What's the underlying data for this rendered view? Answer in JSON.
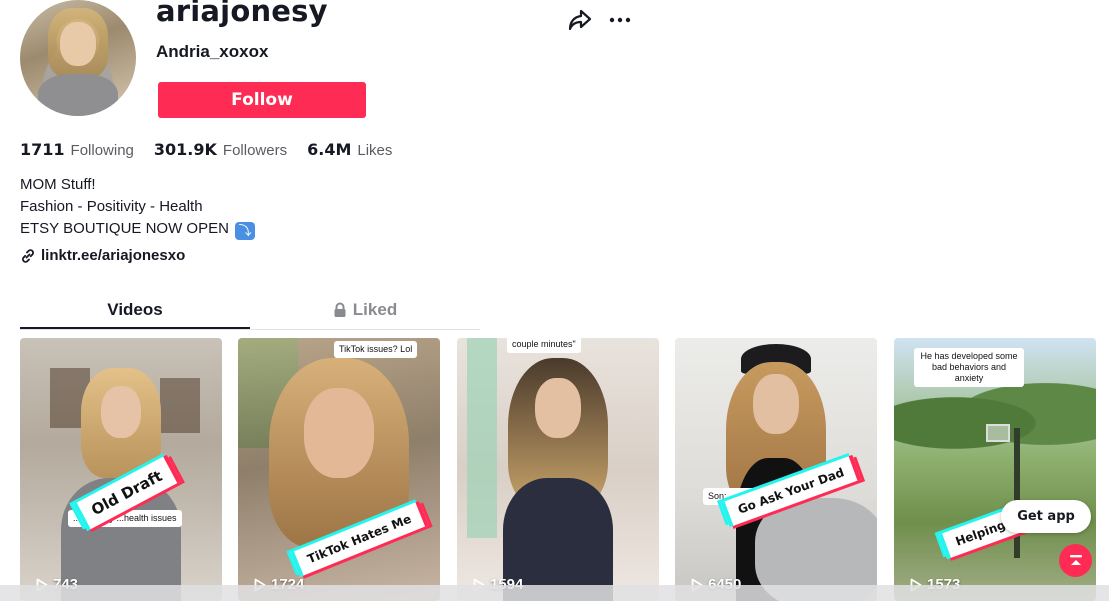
{
  "profile": {
    "username": "ariajonesy",
    "nickname": "Andria_xoxox",
    "follow_label": "Follow",
    "avatar_alt": "avatar"
  },
  "stats": {
    "following_count": "1711",
    "following_label": "Following",
    "followers_count": "301.9K",
    "followers_label": "Followers",
    "likes_count": "6.4M",
    "likes_label": "Likes"
  },
  "bio": {
    "line1": "MOM Stuff!",
    "line2": "Fashion - Positivity - Health",
    "line3": "ETSY BOUTIQUE NOW OPEN",
    "line3_emoji": "⤵"
  },
  "link": {
    "text": "linktr.ee/ariajonesxo"
  },
  "tabs": [
    {
      "label": "Videos",
      "active": true
    },
    {
      "label": "Liked",
      "active": false,
      "icon": "lock-icon"
    }
  ],
  "videos": [
    {
      "views": "743",
      "tag": "Old Draft",
      "caption": "",
      "note": "...all of my ...health issues"
    },
    {
      "views": "1724",
      "tag": "TikTok Hates Me",
      "caption": "TikTok issues? Lol",
      "note": ""
    },
    {
      "views": "1594",
      "tag": "",
      "caption": "couple minutes\"",
      "note": ""
    },
    {
      "views": "6450",
      "tag": "Go Ask Your Dad",
      "caption": "",
      "note": "Son: ...dad"
    },
    {
      "views": "1573",
      "tag": "Helping C",
      "caption": "He has developed some bad behaviors and anxiety",
      "note": ""
    }
  ],
  "floating": {
    "get_app_label": "Get app"
  },
  "colors": {
    "brand_red": "#fe2c55",
    "brand_cyan": "#25f4ee",
    "text_primary": "#161823",
    "text_secondary": "#5b5c63"
  },
  "icons": {
    "share": "share-icon",
    "more": "more-icon",
    "link": "link-icon",
    "lock": "lock-icon",
    "play": "play-icon",
    "scroll_top": "scroll-top-icon"
  }
}
